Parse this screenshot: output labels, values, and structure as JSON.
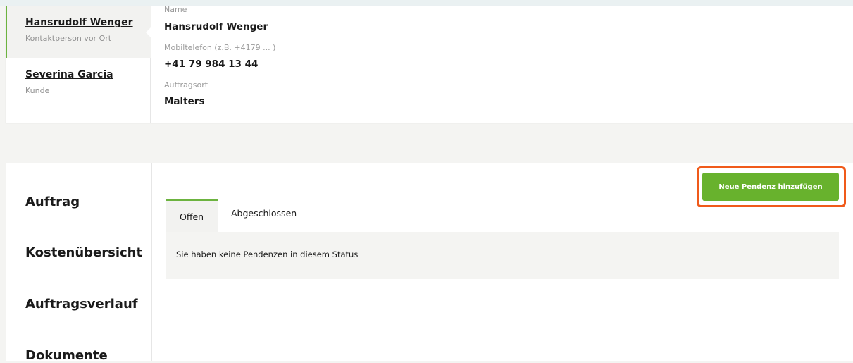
{
  "contacts": [
    {
      "name": "Hansrudolf Wenger",
      "role": "Kontaktperson vor Ort",
      "active": true
    },
    {
      "name": "Severina Garcia",
      "role": "Kunde",
      "active": false
    }
  ],
  "details": {
    "name_label": "Name",
    "name_value": "Hansrudolf Wenger",
    "phone_label": "Mobiltelefon (z.B. +4179 ... )",
    "phone_value": "+41 79 984 13 44",
    "location_label": "Auftragsort",
    "location_value": "Malters"
  },
  "sidenav": {
    "items": [
      "Auftrag",
      "Kostenübersicht",
      "Auftragsverlauf",
      "Dokumente"
    ]
  },
  "actions": {
    "add_label": "Neue Pendenz hinzufügen"
  },
  "tabs": [
    "Offen",
    "Abgeschlossen"
  ],
  "empty_message": "Sie haben keine Pendenzen in diesem Status",
  "colors": {
    "accent_green": "#68b22d",
    "highlight_orange": "#f05a1a"
  }
}
